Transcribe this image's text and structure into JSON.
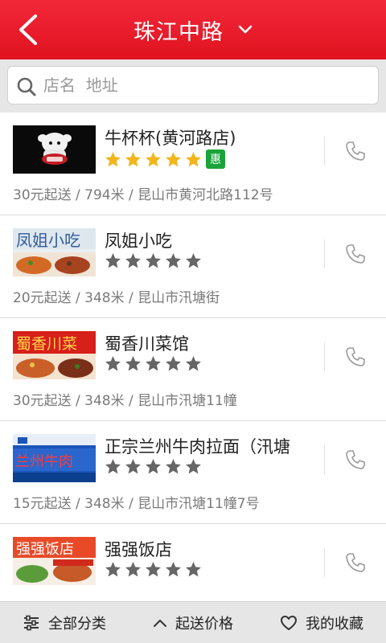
{
  "header": {
    "title": "珠江中路"
  },
  "search": {
    "placeholder": "店名  地址"
  },
  "stores": [
    {
      "name": "牛杯杯(黄河路店)",
      "rating": 5,
      "rated": true,
      "badge": "惠",
      "meta": "30元起送 / 794米 / 昆山市黄河北路112号"
    },
    {
      "name": "凤姐小吃",
      "rating": 5,
      "rated": false,
      "meta": "20元起送 / 348米 / 昆山市汛塘街"
    },
    {
      "name": "蜀香川菜馆",
      "rating": 5,
      "rated": false,
      "meta": "30元起送 / 348米 / 昆山市汛塘11幢"
    },
    {
      "name": "正宗兰州牛肉拉面（汛塘",
      "rating": 5,
      "rated": false,
      "meta": "15元起送 / 348米 / 昆山市汛塘11幢7号"
    },
    {
      "name": "强强饭店",
      "rating": 5,
      "rated": false,
      "meta": ""
    }
  ],
  "bottom_bar": {
    "categories": "全部分类",
    "price": "起送价格",
    "favorites": "我的收藏"
  },
  "colors": {
    "accent": "#e8192c",
    "star_gold": "#f2b51c",
    "star_gray": "#666666",
    "badge": "#1aa33a"
  }
}
